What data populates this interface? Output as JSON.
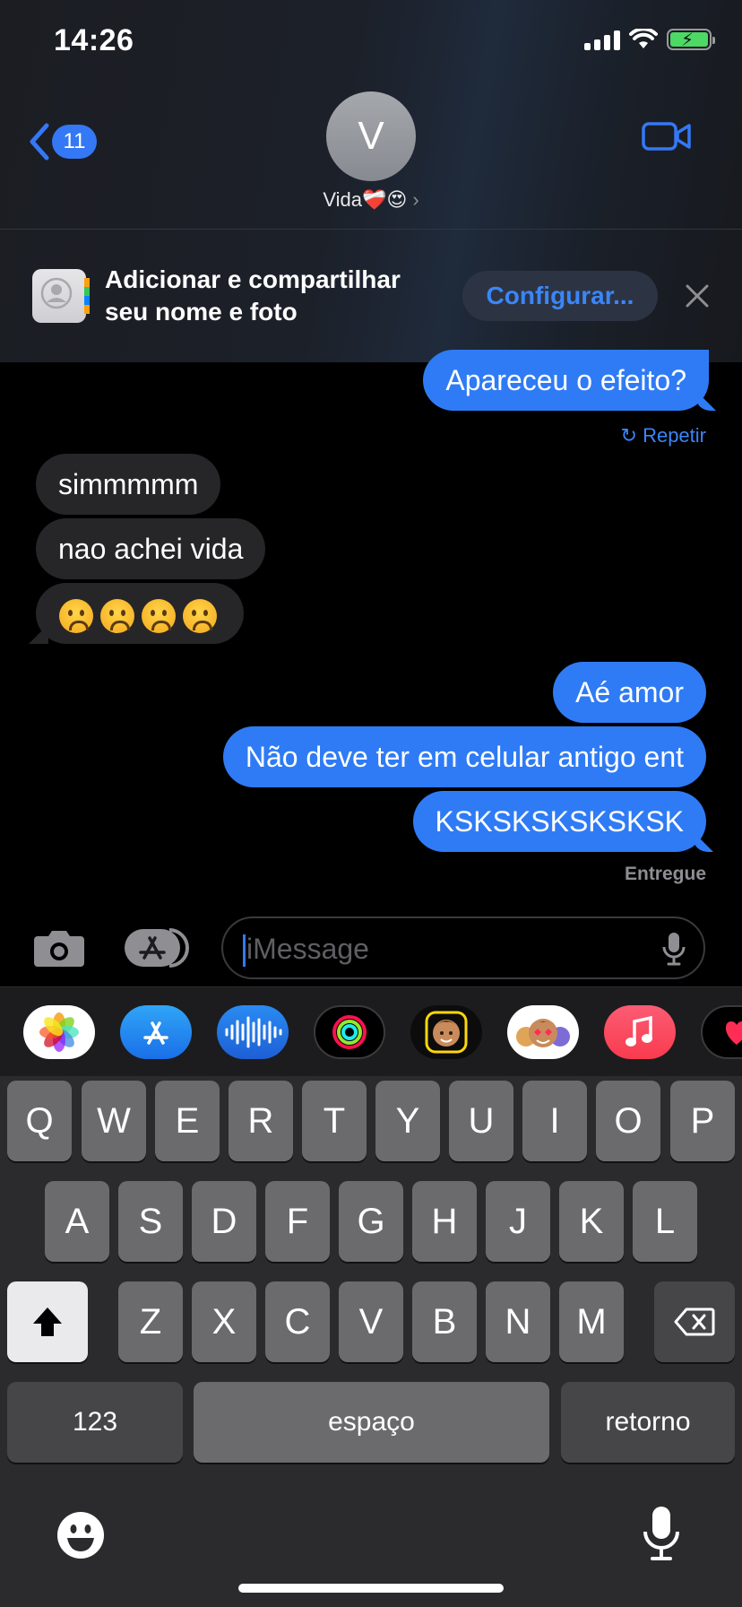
{
  "status_bar": {
    "time": "14:26",
    "icons": [
      "signal-icon",
      "wifi-icon",
      "battery-charging-icon"
    ]
  },
  "header": {
    "back_badge": "11",
    "avatar_initial": "V",
    "contact_name": "Vida❤️‍🩹😍",
    "video_icon": "video-camera-icon"
  },
  "share_banner": {
    "text": "Adicionar e compartilhar seu nome e foto",
    "button": "Configurar...",
    "close_icon": "close-icon"
  },
  "messages": [
    {
      "from": "me",
      "text": "Apareceu o efeito?"
    },
    {
      "from": "them",
      "text": "simmmmm"
    },
    {
      "from": "them",
      "text": "nao achei vida"
    },
    {
      "from": "them",
      "text": "☹️☹️☹️☹️"
    },
    {
      "from": "me",
      "text": "Aé amor"
    },
    {
      "from": "me",
      "text": "Não deve ter em celular antigo ent"
    },
    {
      "from": "me",
      "text": "KSKSKSKSKSKSK"
    }
  ],
  "retry_label": "Repetir",
  "delivered_label": "Entregue",
  "input": {
    "placeholder": "iMessage"
  },
  "app_strip": [
    "photos-app-icon",
    "app-store-icon",
    "audio-message-icon",
    "activity-icon",
    "memoji-icon",
    "memoji-stickers-icon",
    "music-icon",
    "digital-touch-icon"
  ],
  "keyboard": {
    "row1": [
      "Q",
      "W",
      "E",
      "R",
      "T",
      "Y",
      "U",
      "I",
      "O",
      "P"
    ],
    "row2": [
      "A",
      "S",
      "D",
      "F",
      "G",
      "H",
      "J",
      "K",
      "L"
    ],
    "row3": [
      "Z",
      "X",
      "C",
      "V",
      "B",
      "N",
      "M"
    ],
    "numbers": "123",
    "space": "espaço",
    "return": "retorno"
  },
  "colors": {
    "accent": "#2f7bf5",
    "incoming_bubble": "#262628",
    "keyboard_bg": "#2b2b2d"
  }
}
